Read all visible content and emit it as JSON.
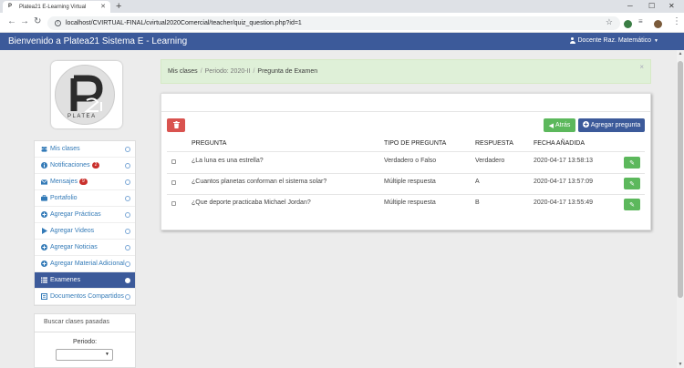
{
  "browser": {
    "tab_title": "Platea21 E-Learning Virtual",
    "url": "localhost/CVIRTUAL-FINAL/cvirtual2020Comercial/teacher/quiz_question.php?id=1"
  },
  "navbar": {
    "brand": "Bienvenido a Platea21 Sistema E - Learning",
    "user": "Docente Raz. Matemático"
  },
  "logo": {
    "text": "PLATEA"
  },
  "sidebar": {
    "items": [
      {
        "label": "Mis clases",
        "icon": "users-icon",
        "badge": ""
      },
      {
        "label": "Notificaciones",
        "icon": "info-icon",
        "badge": "2"
      },
      {
        "label": "Mensajes",
        "icon": "envelope-icon",
        "badge": "9"
      },
      {
        "label": "Portafolio",
        "icon": "suitcase-icon",
        "badge": ""
      },
      {
        "label": "Agregar Prácticas",
        "icon": "plus-circle-icon",
        "badge": ""
      },
      {
        "label": "Agregar Videos",
        "icon": "play-icon",
        "badge": ""
      },
      {
        "label": "Agregar Noticias",
        "icon": "plus-circle-icon",
        "badge": ""
      },
      {
        "label": "Agregar Material Adicional",
        "icon": "plus-circle-icon",
        "badge": ""
      },
      {
        "label": "Examenes",
        "icon": "list-icon",
        "badge": ""
      },
      {
        "label": "Documentos Compartidos",
        "icon": "file-icon",
        "badge": ""
      }
    ],
    "active": "Examenes",
    "past_classes": {
      "title": "Buscar clases pasadas",
      "period_label": "Periodo:"
    }
  },
  "breadcrumb": {
    "items": [
      "Mis clases",
      "Periodo: 2020-II",
      "Pregunta de Examen"
    ]
  },
  "actions": {
    "back_label": "Atrás",
    "add_label": "Agregar pregunta"
  },
  "table": {
    "headers": [
      "PREGUNTA",
      "TIPO DE PREGUNTA",
      "RESPUESTA",
      "FECHA AÑADIDA"
    ],
    "rows": [
      {
        "question": "¿La luna es una estrella?",
        "type": "Verdadero o Falso",
        "answer": "Verdadero",
        "date": "2020-04-17 13:58:13"
      },
      {
        "question": "¿Cuantos planetas conforman el sistema solar?",
        "type": "Múltiple respuesta",
        "answer": "A",
        "date": "2020-04-17 13:57:09"
      },
      {
        "question": "¿Que deporte practicaba Michael Jordan?",
        "type": "Múltiple respuesta",
        "answer": "B",
        "date": "2020-04-17 13:55:49"
      }
    ]
  },
  "colors": {
    "navbar": "#3c5a9a",
    "success": "#5cb85c",
    "danger": "#d9534f",
    "alert_bg": "#dff0d8"
  }
}
